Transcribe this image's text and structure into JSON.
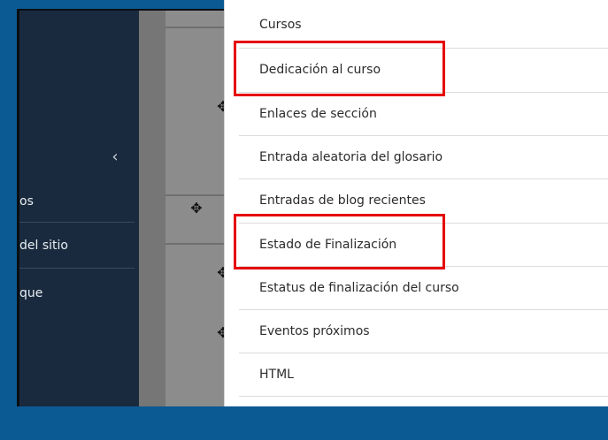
{
  "sidebar": {
    "items": [
      {
        "label": "os"
      },
      {
        "label": "del sitio"
      },
      {
        "label": "que"
      }
    ]
  },
  "icons": {
    "collapse": "chevron-left-icon",
    "move": "move-arrows-icon"
  },
  "block_menu": {
    "items": [
      {
        "label": "Cursos"
      },
      {
        "label": "Dedicación al curso"
      },
      {
        "label": "Enlaces de sección"
      },
      {
        "label": "Entrada aleatoria del glosario"
      },
      {
        "label": "Entradas de blog recientes"
      },
      {
        "label": "Estado de Finalización"
      },
      {
        "label": "Estatus de finalización del curso"
      },
      {
        "label": "Eventos próximos"
      },
      {
        "label": "HTML"
      }
    ],
    "highlighted": [
      "Dedicación al curso",
      "Estado de Finalización"
    ]
  },
  "colors": {
    "page_border": "#0b5a94",
    "sidebar_bg": "#1a2a3e",
    "highlight": "#e60000"
  }
}
